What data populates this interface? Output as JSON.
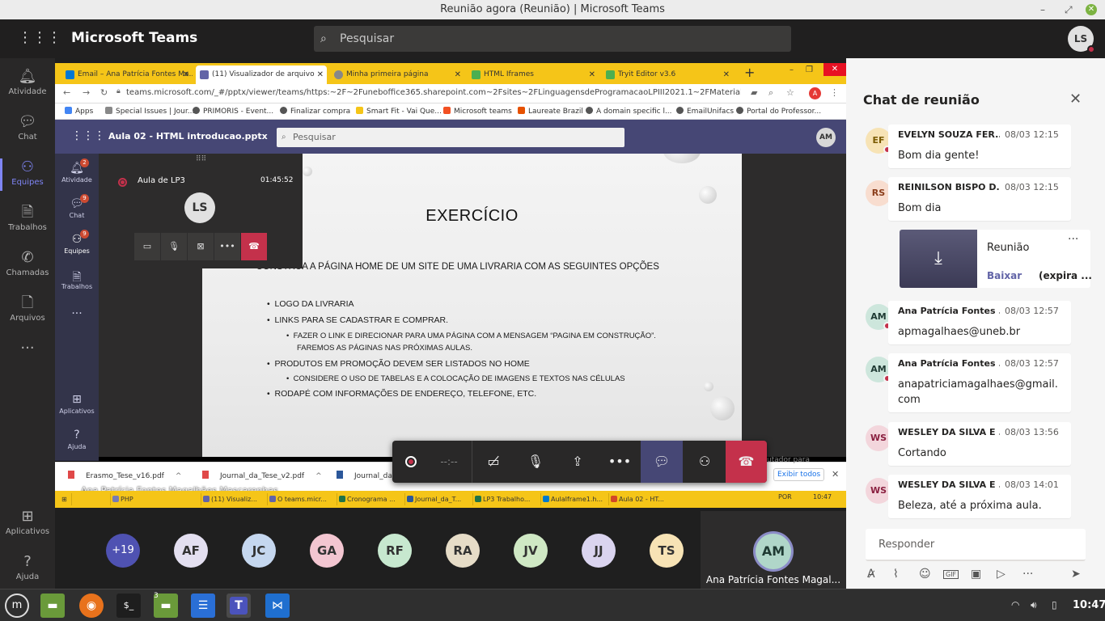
{
  "window": {
    "title": "Reunião agora (Reunião) | Microsoft Teams"
  },
  "teams": {
    "app_name": "Microsoft Teams",
    "search_placeholder": "Pesquisar",
    "user_initials": "LS",
    "rail": [
      {
        "icon": "bell-icon",
        "label": "Atividade"
      },
      {
        "icon": "chat-icon",
        "label": "Chat"
      },
      {
        "icon": "teams-icon",
        "label": "Equipes",
        "active": true
      },
      {
        "icon": "briefcase-icon",
        "label": "Trabalhos"
      },
      {
        "icon": "phone-icon",
        "label": "Chamadas"
      },
      {
        "icon": "file-icon",
        "label": "Arquivos"
      },
      {
        "icon": "more-icon",
        "label": "···"
      },
      {
        "icon": "apps-icon",
        "label": "Aplicativos"
      },
      {
        "icon": "help-icon",
        "label": "Ajuda"
      }
    ]
  },
  "shared_screen": {
    "browser_tabs": [
      {
        "label": "Email – Ana Patrícia Fontes Ma...",
        "color": "#0078d4"
      },
      {
        "label": "(11) Visualizador de arquivo",
        "color": "#6264a7",
        "active": true
      },
      {
        "label": "Minha primeira página",
        "color": "#888888"
      },
      {
        "label": "HTML Iframes",
        "color": "#4caf50"
      },
      {
        "label": "Tryit Editor v3.6",
        "color": "#4caf50"
      }
    ],
    "url": "teams.microsoft.com/_#/pptx/viewer/teams/https:~2F~2Funeboffice365.sharepoint.com~2Fsites~2FLinguagensdeProgramacaoLPIII2021.1~2FMaterial%20de%20Aula~2...",
    "bookmarks": [
      {
        "label": "Apps",
        "color": "#4285f4"
      },
      {
        "label": "Special Issues | Jour...",
        "color": "#888888"
      },
      {
        "label": "PRIMORIS - Event...",
        "color": "#555555"
      },
      {
        "label": "Finalizar compra",
        "color": "#555555"
      },
      {
        "label": "Smart Fit - Vai Que...",
        "color": "#f5c518"
      },
      {
        "label": "Microsoft teams",
        "color": "#f25022"
      },
      {
        "label": "Laureate Brazil",
        "color": "#e65100"
      },
      {
        "label": "A domain specific l...",
        "color": "#555555"
      },
      {
        "label": "EmailUnifacs",
        "color": "#555555"
      },
      {
        "label": "Portal do Professor...",
        "color": "#555555"
      }
    ],
    "file_name": "Aula 02 - HTML introducao.pptx",
    "inner_search": "Pesquisar",
    "inner_avatar": "AM",
    "inner_rail": [
      {
        "label": "Atividade",
        "badge": "2"
      },
      {
        "label": "Chat",
        "badge": "9"
      },
      {
        "label": "Equipes",
        "badge": "9",
        "active": true
      },
      {
        "label": "Trabalhos",
        "badge": ""
      },
      {
        "label": "···",
        "badge": ""
      },
      {
        "label": "Aplicativos",
        "badge": ""
      },
      {
        "label": "Ajuda",
        "badge": ""
      }
    ],
    "mini_call": {
      "name": "Aula de LP3",
      "time": "01:45:52",
      "initials": "LS"
    },
    "slide": {
      "title": "EXERCÍCIO",
      "lines": [
        "Construa a página home de um site de uma livraria com as seguintes opções",
        "Logo da livraria",
        "Links para se cadastrar e comprar.",
        "Fazer o link e direcionar para uma página com a mensagem “pagina em construção”.",
        "Faremos as páginas nas próximas aulas.",
        "Produtos em promoção devem ser listados no home",
        "Considere o uso de tabelas e a colocação de imagens e textos nas células",
        "Rodapé com informações de endereço, telefone, etc."
      ]
    },
    "presenter": "Ana Patrícia Fontes Magalhães Mascarenhas",
    "downloads": [
      {
        "label": "Erasmo_Tese_v16.pdf",
        "type": "pdf"
      },
      {
        "label": "Journal_da_Tese_v2.pdf",
        "type": "pdf"
      },
      {
        "label": "Journal_da_",
        "type": "doc"
      }
    ],
    "downloads_show_all": "Exibir todos",
    "overlay_text": "utador para",
    "taskbar": [
      {
        "label": "PHP",
        "color": "#777bb3"
      },
      {
        "label": "(11) Visualiz...",
        "color": "#6264a7"
      },
      {
        "label": "O teams.micr...",
        "color": "#6264a7"
      },
      {
        "label": "Cronograma ...",
        "color": "#217346"
      },
      {
        "label": "Journal_da_T...",
        "color": "#2b579a"
      },
      {
        "label": "LP3 Trabalho...",
        "color": "#217346"
      },
      {
        "label": "AulaIframe1.h...",
        "color": "#007acc"
      },
      {
        "label": "Aula 02 - HT...",
        "color": "#d24726"
      }
    ],
    "taskbar_lang": "POR",
    "taskbar_clock": "10:47"
  },
  "call_controls": {
    "timer": "--:--",
    "buttons": [
      "record",
      "camera-off",
      "mic-off",
      "share-screen",
      "more",
      "chat",
      "participants",
      "hang-up"
    ]
  },
  "participants": {
    "overflow": "+19",
    "avatars": [
      {
        "initials": "AF",
        "color": "#e3dff0"
      },
      {
        "initials": "JC",
        "color": "#c5d7ef"
      },
      {
        "initials": "GA",
        "color": "#f3c6d1"
      },
      {
        "initials": "RF",
        "color": "#c7e8cf"
      },
      {
        "initials": "RA",
        "color": "#e6dcc7"
      },
      {
        "initials": "JV",
        "color": "#cfe8c4"
      },
      {
        "initials": "JJ",
        "color": "#dad4ef"
      },
      {
        "initials": "TS",
        "color": "#f7e3b5"
      }
    ],
    "me": {
      "initials": "AM",
      "name": "Ana Patrícia Fontes Magal..."
    }
  },
  "chat": {
    "title": "Chat de reunião",
    "messages": [
      {
        "initials": "EF",
        "color": "#f7e3b5",
        "author": "EVELYN SOUZA FER...",
        "time": "08/03 12:15",
        "text": "Bom dia gente!"
      },
      {
        "initials": "RS",
        "color": "#f8ddcf",
        "author": "REINILSON BISPO D...",
        "time": "08/03 12:15",
        "text": "Bom dia"
      },
      {
        "initials": "AM",
        "color": "#cde6dc",
        "author": "Ana Patrícia Fontes ...",
        "time": "08/03 12:57",
        "text": "apmagalhaes@uneb.br"
      },
      {
        "initials": "AM",
        "color": "#cde6dc",
        "author": "Ana Patrícia Fontes ...",
        "time": "08/03 12:57",
        "text": "anapatriciamagalhaes@gmail.com"
      },
      {
        "initials": "WS",
        "color": "#f3d6dc",
        "author": "WESLEY DA SILVA E ...",
        "time": "08/03 13:56",
        "text": "Cortando"
      },
      {
        "initials": "WS",
        "color": "#f3d6dc",
        "author": "WESLEY DA SILVA E ...",
        "time": "08/03 14:01",
        "text": "Beleza, até a próxima aula."
      }
    ],
    "recording": {
      "name": "Reunião",
      "download": "Baixar",
      "expires": "(expira ..."
    },
    "reply_placeholder": "Responder"
  },
  "panel": {
    "clock": "10:47",
    "workspace_badge": "3"
  }
}
